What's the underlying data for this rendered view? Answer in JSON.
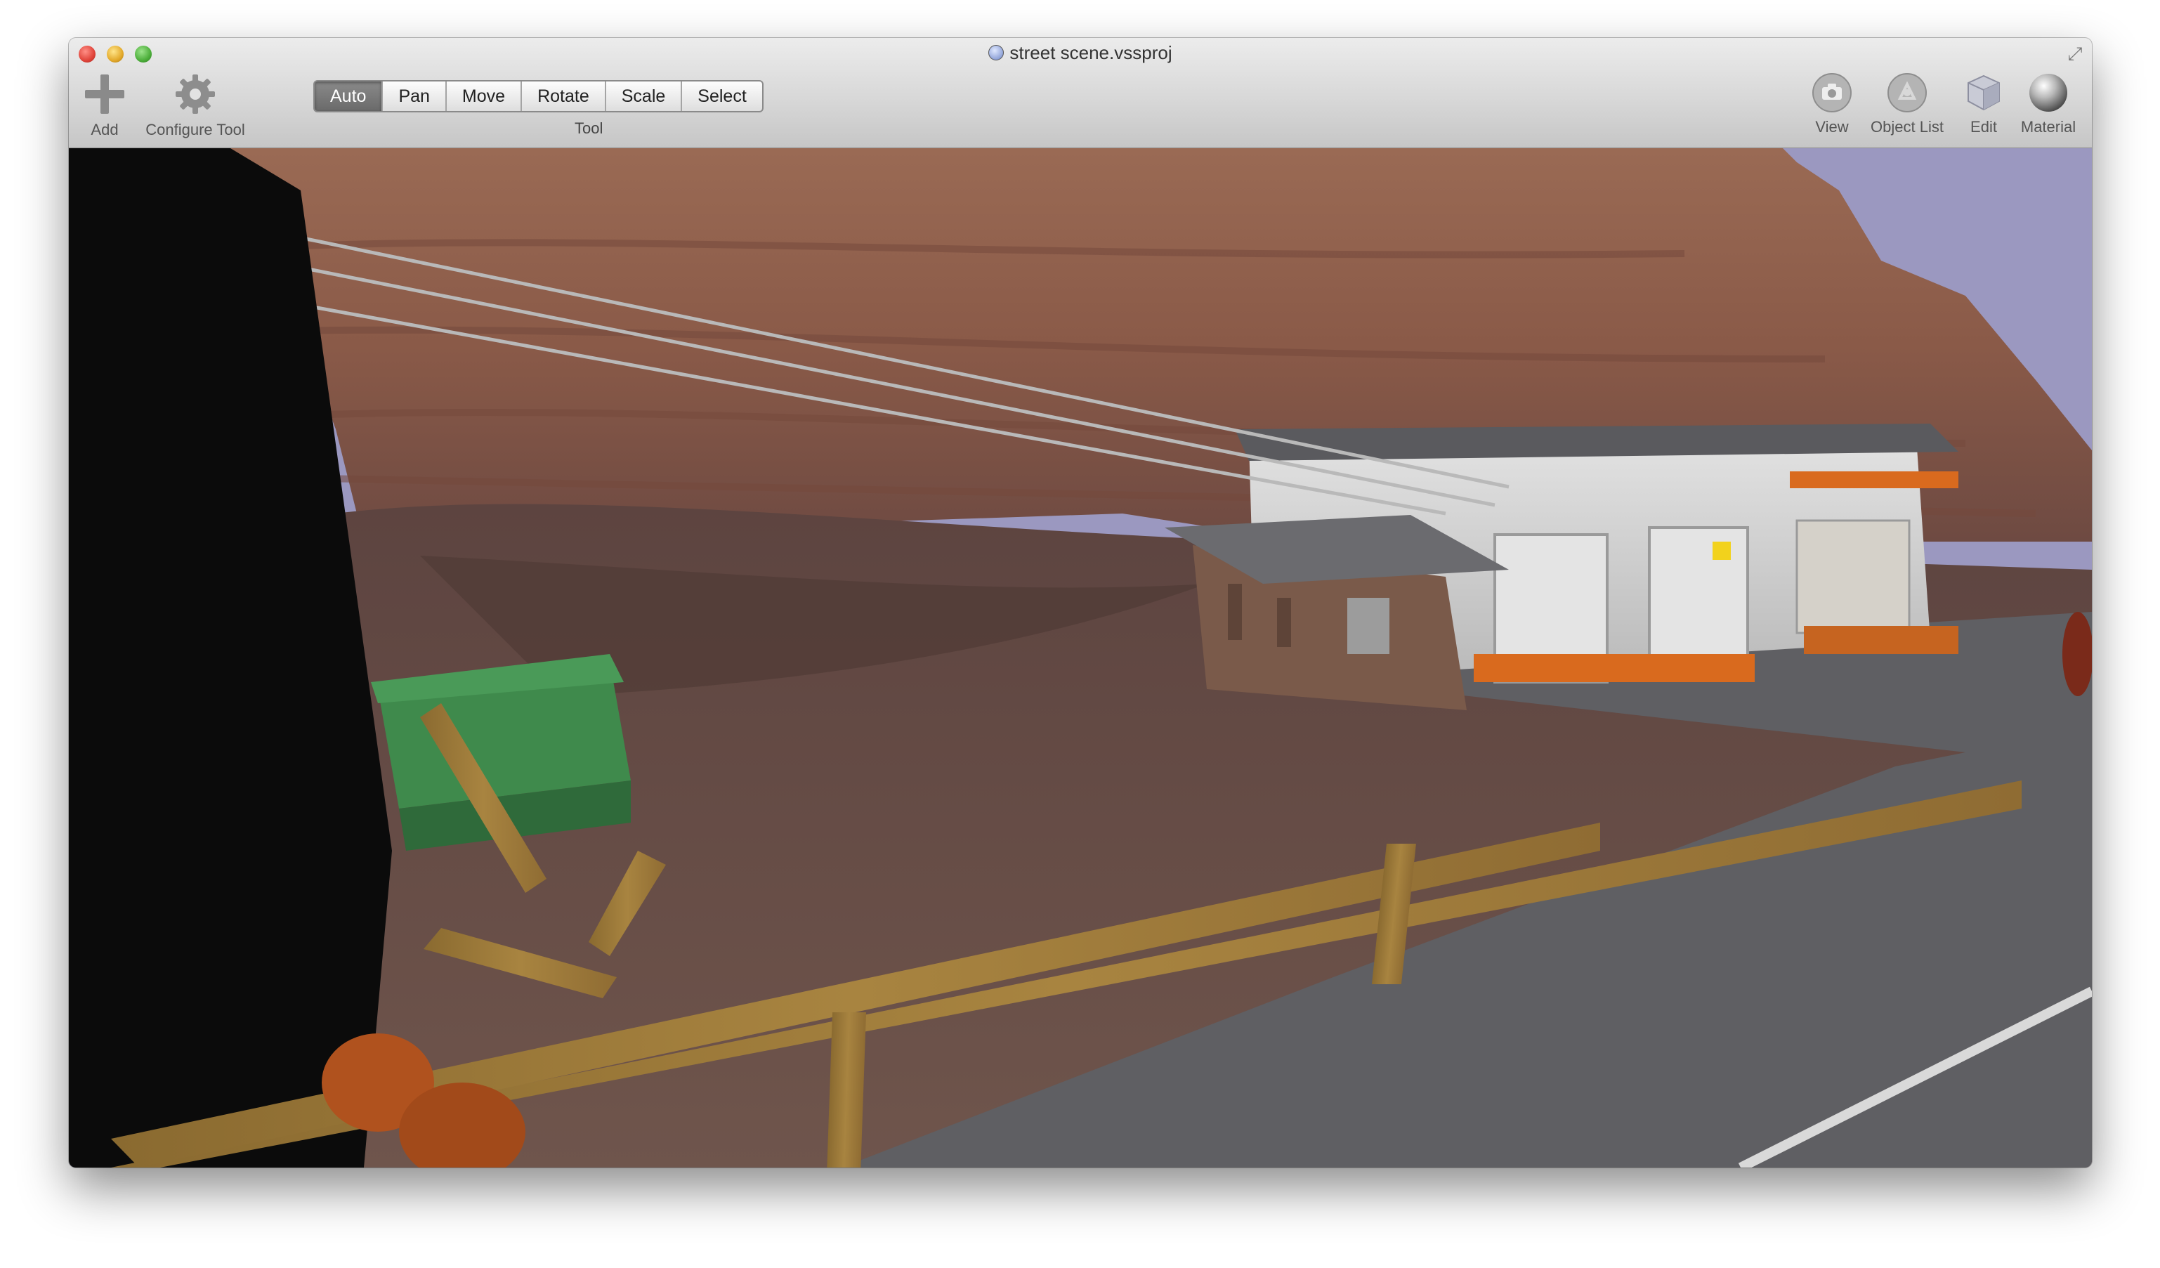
{
  "window": {
    "title": "street scene.vssproj",
    "document_icon": "project-document-icon",
    "fullscreen_icon": "fullscreen-arrows-icon"
  },
  "toolbar": {
    "add": {
      "label": "Add",
      "icon": "plus-icon"
    },
    "configure_tool": {
      "label": "Configure Tool",
      "icon": "gear-icon"
    },
    "tool_segments": [
      {
        "label": "Auto",
        "selected": true
      },
      {
        "label": "Pan",
        "selected": false
      },
      {
        "label": "Move",
        "selected": false
      },
      {
        "label": "Rotate",
        "selected": false
      },
      {
        "label": "Scale",
        "selected": false
      },
      {
        "label": "Select",
        "selected": false
      }
    ],
    "tool_caption": "Tool",
    "right_items": [
      {
        "label": "View",
        "icon": "camera-icon"
      },
      {
        "label": "Object List",
        "icon": "object-list-icon"
      },
      {
        "label": "Edit",
        "icon": "cube-icon"
      },
      {
        "label": "Material",
        "icon": "sphere-icon"
      }
    ]
  },
  "colors": {
    "sky": "#9b98c0",
    "cliff": "#8a5a48",
    "ground": "#6b5048",
    "asphalt": "#5f5f63",
    "dumpster": "#3f8a4c",
    "wood": "#a07a3a",
    "building_wall": "#d6d6d6",
    "brick": "#7a5a4a",
    "accent_orange": "#d96a1e"
  }
}
